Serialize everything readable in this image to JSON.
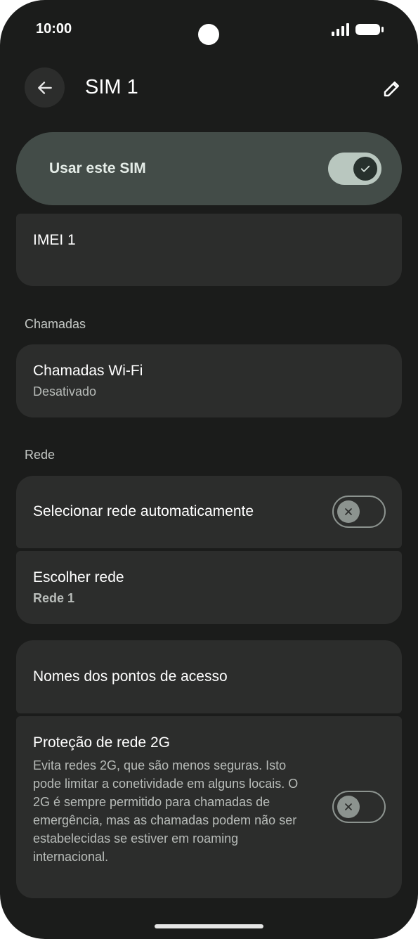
{
  "status_bar": {
    "time": "10:00"
  },
  "header": {
    "title": "SIM 1"
  },
  "use_sim": {
    "label": "Usar este SIM",
    "enabled": true
  },
  "imei": {
    "title": "IMEI 1"
  },
  "sections": {
    "calls": "Chamadas",
    "network": "Rede"
  },
  "wifi_calling": {
    "title": "Chamadas Wi-Fi",
    "subtitle": "Desativado"
  },
  "auto_network": {
    "title": "Selecionar rede automaticamente",
    "enabled": false
  },
  "choose_network": {
    "title": "Escolher rede",
    "subtitle": "Rede 1"
  },
  "apn": {
    "title": "Nomes dos pontos de acesso"
  },
  "protection_2g": {
    "title": "Proteção de rede 2G",
    "description": "Evita redes 2G, que são menos seguras. Isto pode limitar a conetividade em alguns locais. O 2G é sempre permitido para chamadas de emergência, mas as chamadas podem não ser estabelecidas se estiver em roaming internacional.",
    "enabled": false
  },
  "icons": {
    "back": "arrow-left-icon",
    "edit": "pencil-icon",
    "check": "check-icon",
    "close": "close-icon",
    "signal": "signal-icon",
    "battery": "battery-icon"
  },
  "colors": {
    "background": "#1b1c1b",
    "card": "#2c2d2c",
    "toggle_card": "#434c48",
    "switch_on_track": "#b9c7bf",
    "switch_off_outline": "#8c938f"
  }
}
